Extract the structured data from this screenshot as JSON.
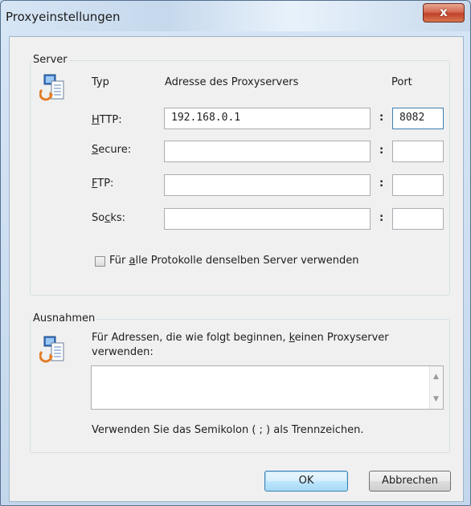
{
  "window": {
    "title": "Proxyeinstellungen",
    "close_glyph": "x"
  },
  "server": {
    "legend": "Server",
    "headers": {
      "type": "Typ",
      "address": "Adresse des Proxyservers",
      "port": "Port"
    },
    "rows": [
      {
        "label_pre": "",
        "label_accel": "H",
        "label_post": "TTP:",
        "address": "192.168.0.1",
        "port": "8082"
      },
      {
        "label_pre": "",
        "label_accel": "S",
        "label_post": "ecure:",
        "address": "",
        "port": ""
      },
      {
        "label_pre": "",
        "label_accel": "F",
        "label_post": "TP:",
        "address": "",
        "port": ""
      },
      {
        "label_pre": "So",
        "label_accel": "c",
        "label_post": "ks:",
        "address": "",
        "port": ""
      }
    ],
    "colon": ":",
    "same_server": {
      "pre": "Für ",
      "accel": "a",
      "post": "lle Protokolle denselben Server verwenden",
      "checked": false
    }
  },
  "exceptions": {
    "legend": "Ausnahmen",
    "desc_pre": "Für Adressen, die wie folgt beginnen, ",
    "desc_accel": "k",
    "desc_post": "einen Proxyserver",
    "desc_line2": "verwenden:",
    "value": "",
    "hint": "Verwenden Sie das Semikolon ( ; ) als Trennzeichen."
  },
  "buttons": {
    "ok": "OK",
    "cancel": "Abbrechen"
  },
  "icons": {
    "server": "network-computer-icon",
    "exceptions": "network-computer-icon"
  },
  "colors": {
    "accent": "#3c7fb1",
    "close": "#c1412b",
    "window": "#f0f0f0"
  }
}
